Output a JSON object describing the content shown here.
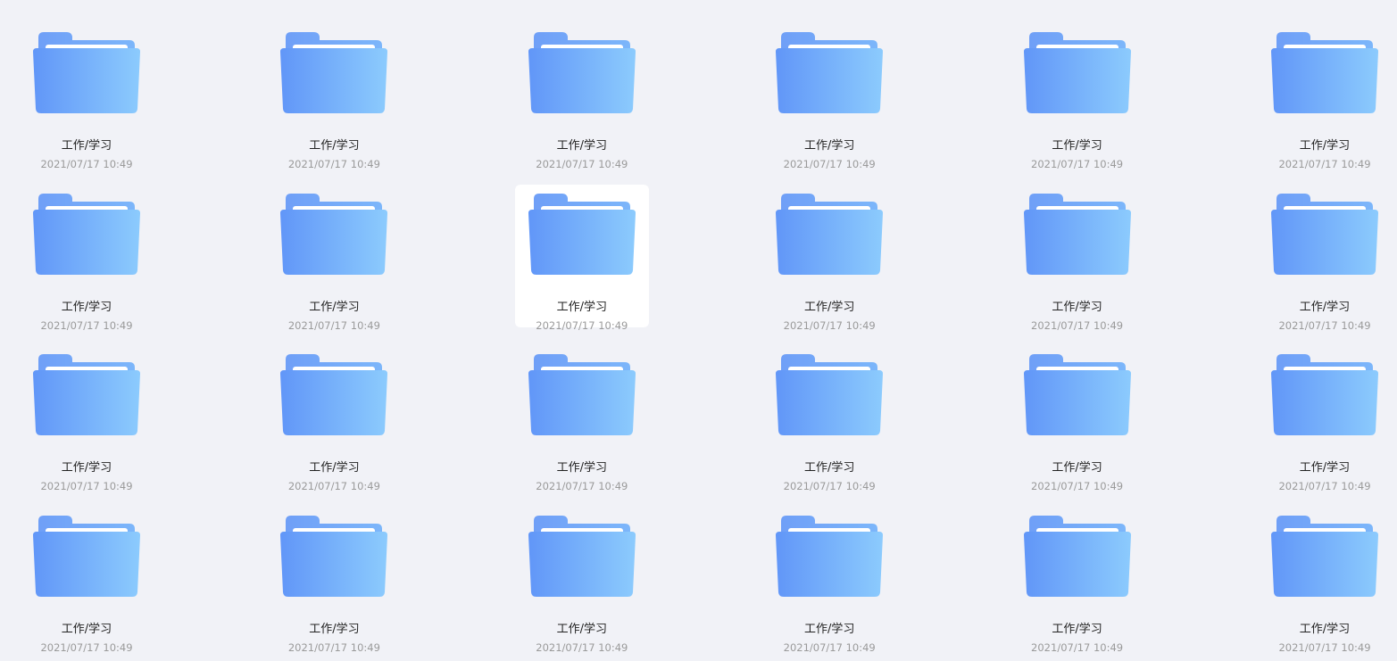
{
  "grid": {
    "columns": 6,
    "rows": 4,
    "selected_index": 8,
    "items": [
      {
        "name": "工作/学习",
        "date": "2021/07/17 10:49",
        "icon": "folder-icon"
      },
      {
        "name": "工作/学习",
        "date": "2021/07/17 10:49",
        "icon": "folder-icon"
      },
      {
        "name": "工作/学习",
        "date": "2021/07/17 10:49",
        "icon": "folder-icon"
      },
      {
        "name": "工作/学习",
        "date": "2021/07/17 10:49",
        "icon": "folder-icon"
      },
      {
        "name": "工作/学习",
        "date": "2021/07/17 10:49",
        "icon": "folder-icon"
      },
      {
        "name": "工作/学习",
        "date": "2021/07/17 10:49",
        "icon": "folder-icon"
      },
      {
        "name": "工作/学习",
        "date": "2021/07/17 10:49",
        "icon": "folder-icon"
      },
      {
        "name": "工作/学习",
        "date": "2021/07/17 10:49",
        "icon": "folder-icon"
      },
      {
        "name": "工作/学习",
        "date": "2021/07/17 10:49",
        "icon": "folder-icon"
      },
      {
        "name": "工作/学习",
        "date": "2021/07/17 10:49",
        "icon": "folder-icon"
      },
      {
        "name": "工作/学习",
        "date": "2021/07/17 10:49",
        "icon": "folder-icon"
      },
      {
        "name": "工作/学习",
        "date": "2021/07/17 10:49",
        "icon": "folder-icon"
      },
      {
        "name": "工作/学习",
        "date": "2021/07/17 10:49",
        "icon": "folder-icon"
      },
      {
        "name": "工作/学习",
        "date": "2021/07/17 10:49",
        "icon": "folder-icon"
      },
      {
        "name": "工作/学习",
        "date": "2021/07/17 10:49",
        "icon": "folder-icon"
      },
      {
        "name": "工作/学习",
        "date": "2021/07/17 10:49",
        "icon": "folder-icon"
      },
      {
        "name": "工作/学习",
        "date": "2021/07/17 10:49",
        "icon": "folder-icon"
      },
      {
        "name": "工作/学习",
        "date": "2021/07/17 10:49",
        "icon": "folder-icon"
      },
      {
        "name": "工作/学习",
        "date": "2021/07/17 10:49",
        "icon": "folder-icon"
      },
      {
        "name": "工作/学习",
        "date": "2021/07/17 10:49",
        "icon": "folder-icon"
      },
      {
        "name": "工作/学习",
        "date": "2021/07/17 10:49",
        "icon": "folder-icon"
      },
      {
        "name": "工作/学习",
        "date": "2021/07/17 10:49",
        "icon": "folder-icon"
      },
      {
        "name": "工作/学习",
        "date": "2021/07/17 10:49",
        "icon": "folder-icon"
      },
      {
        "name": "工作/学习",
        "date": "2021/07/17 10:49",
        "icon": "folder-icon"
      }
    ]
  },
  "colors": {
    "background": "#f1f2f7",
    "selected_tile": "#ffffff",
    "folder_gradient_start": "#6196f8",
    "folder_gradient_end": "#8ccbfd",
    "folder_tab": "#7aaef8",
    "name_text": "#222222",
    "date_text": "#9a9a9a"
  }
}
